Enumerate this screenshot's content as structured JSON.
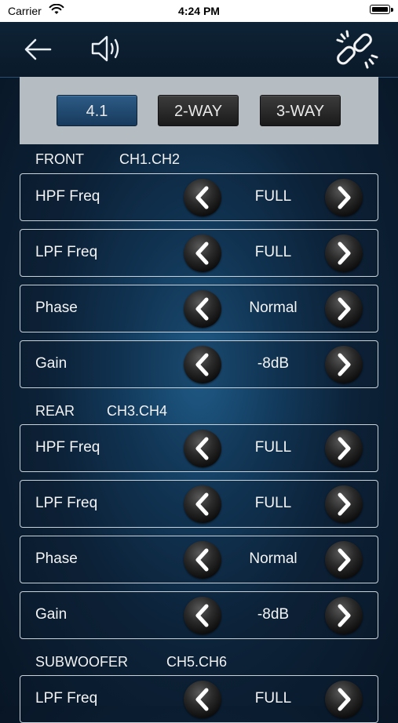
{
  "status_bar": {
    "carrier": "Carrier",
    "time": "4:24 PM"
  },
  "modes": [
    {
      "label": "4.1",
      "active": true
    },
    {
      "label": "2-WAY",
      "active": false
    },
    {
      "label": "3-WAY",
      "active": false
    }
  ],
  "sections": [
    {
      "name": "FRONT",
      "channels": "CH1.CH2",
      "rows": [
        {
          "label": "HPF Freq",
          "value": "FULL"
        },
        {
          "label": "LPF Freq",
          "value": "FULL"
        },
        {
          "label": "Phase",
          "value": "Normal"
        },
        {
          "label": "Gain",
          "value": "-8dB"
        }
      ]
    },
    {
      "name": "REAR",
      "channels": "CH3.CH4",
      "rows": [
        {
          "label": "HPF Freq",
          "value": "FULL"
        },
        {
          "label": "LPF Freq",
          "value": "FULL"
        },
        {
          "label": "Phase",
          "value": "Normal"
        },
        {
          "label": "Gain",
          "value": "-8dB"
        }
      ]
    },
    {
      "name": "SUBWOOFER",
      "channels": "CH5.CH6",
      "rows": [
        {
          "label": "LPF Freq",
          "value": "FULL"
        }
      ]
    }
  ],
  "icons": {
    "back": "back-arrow-icon",
    "sound": "speaker-volume-icon",
    "link": "chain-link-icon",
    "prev": "chevron-left-icon",
    "next": "chevron-right-icon"
  }
}
